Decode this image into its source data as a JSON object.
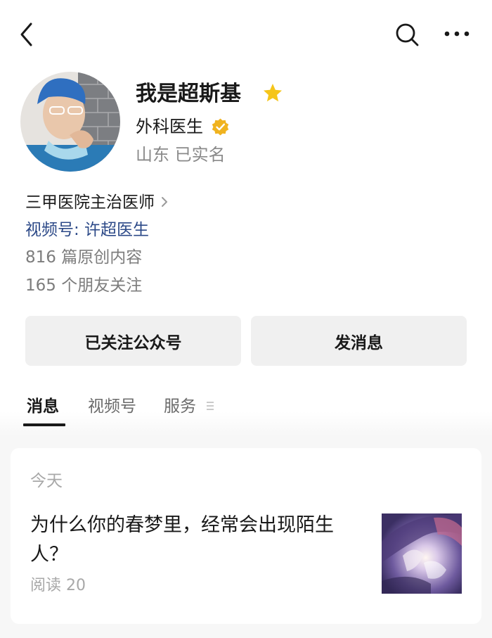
{
  "profile": {
    "name": "我是超斯基",
    "title": "外科医生",
    "location": "山东 已实名"
  },
  "info": {
    "organization": "三甲医院主治医师",
    "channel": "视频号: 许超医生",
    "articles": "816 篇原创内容",
    "friends": "165 个朋友关注"
  },
  "actions": {
    "follow_label": "已关注公众号",
    "message_label": "发消息"
  },
  "tabs": [
    {
      "label": "消息"
    },
    {
      "label": "视频号"
    },
    {
      "label": "服务"
    }
  ],
  "feed": {
    "date": "今天",
    "articles": [
      {
        "title": "为什么你的春梦里，经常会出现陌生人？",
        "read_count": "阅读 20"
      }
    ]
  },
  "icons": {
    "back": "back-arrow-icon",
    "search": "search-icon",
    "more": "more-dots-icon",
    "star": "star-icon",
    "verified": "verified-badge-icon",
    "chevron": "chevron-right-icon",
    "menu": "menu-lines-icon"
  },
  "colors": {
    "link_blue": "#2d4a88",
    "star_gold": "#f5c51a",
    "verified_gold": "#f0b31f",
    "button_bg": "#f0f0f0"
  }
}
